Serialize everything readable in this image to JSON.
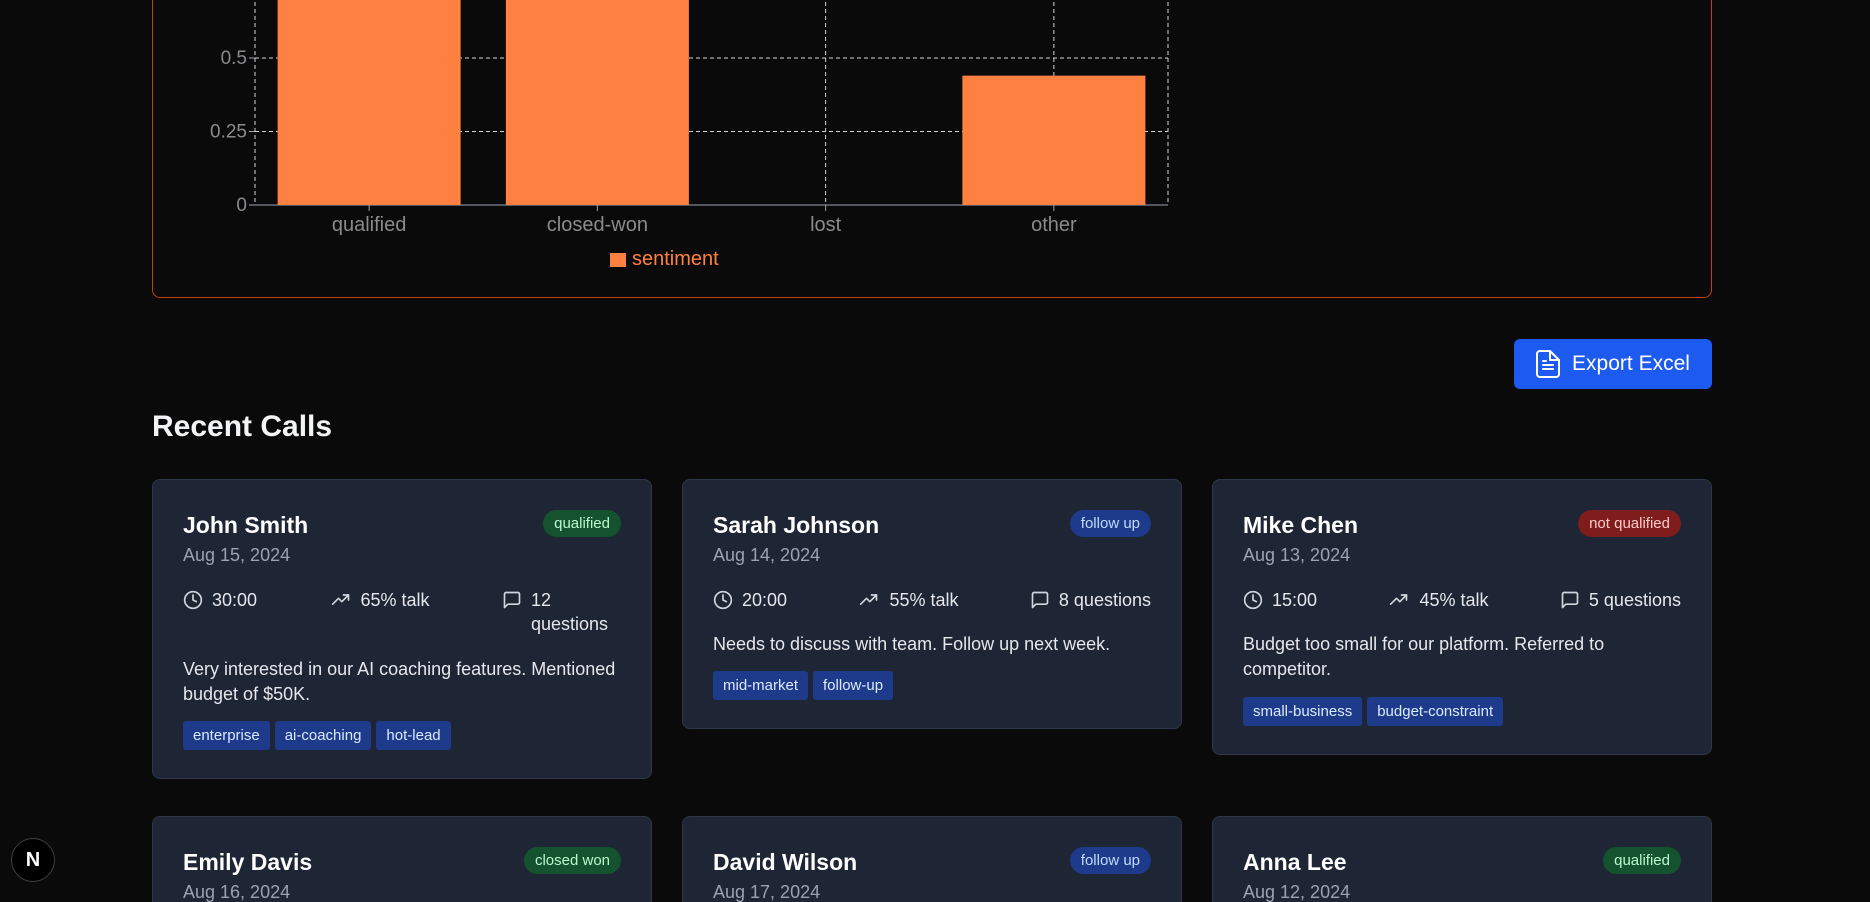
{
  "chart_data": {
    "type": "bar",
    "categories": [
      "qualified",
      "closed-won",
      "lost",
      "other"
    ],
    "series": [
      {
        "name": "sentiment",
        "values": [
          1.0,
          1.0,
          0,
          0.44
        ]
      }
    ],
    "yticks": [
      "0",
      "0.25",
      "0.5"
    ],
    "ylim": [
      0,
      1
    ],
    "grid": true,
    "legend": "bottom",
    "color": "#ff8142"
  },
  "toolbar": {
    "export_label": "Export Excel"
  },
  "section": {
    "title": "Recent Calls"
  },
  "calls": [
    {
      "name": "John Smith",
      "date": "Aug 15, 2024",
      "status": "qualified",
      "duration": "30:00",
      "talk": "65% talk",
      "questions": "12 questions",
      "summary": "Very interested in our AI coaching features. Mentioned budget of $50K.",
      "tags": [
        "enterprise",
        "ai-coaching",
        "hot-lead"
      ]
    },
    {
      "name": "Sarah Johnson",
      "date": "Aug 14, 2024",
      "status": "follow up",
      "duration": "20:00",
      "talk": "55% talk",
      "questions": "8 questions",
      "summary": "Needs to discuss with team. Follow up next week.",
      "tags": [
        "mid-market",
        "follow-up"
      ]
    },
    {
      "name": "Mike Chen",
      "date": "Aug 13, 2024",
      "status": "not qualified",
      "duration": "15:00",
      "talk": "45% talk",
      "questions": "5 questions",
      "summary": "Budget too small for our platform. Referred to competitor.",
      "tags": [
        "small-business",
        "budget-constraint"
      ]
    },
    {
      "name": "Emily Davis",
      "date": "Aug 16, 2024",
      "status": "closed won"
    },
    {
      "name": "David Wilson",
      "date": "Aug 17, 2024",
      "status": "follow up"
    },
    {
      "name": "Anna Lee",
      "date": "Aug 12, 2024",
      "status": "qualified"
    }
  ],
  "badge": {
    "letter": "N"
  }
}
